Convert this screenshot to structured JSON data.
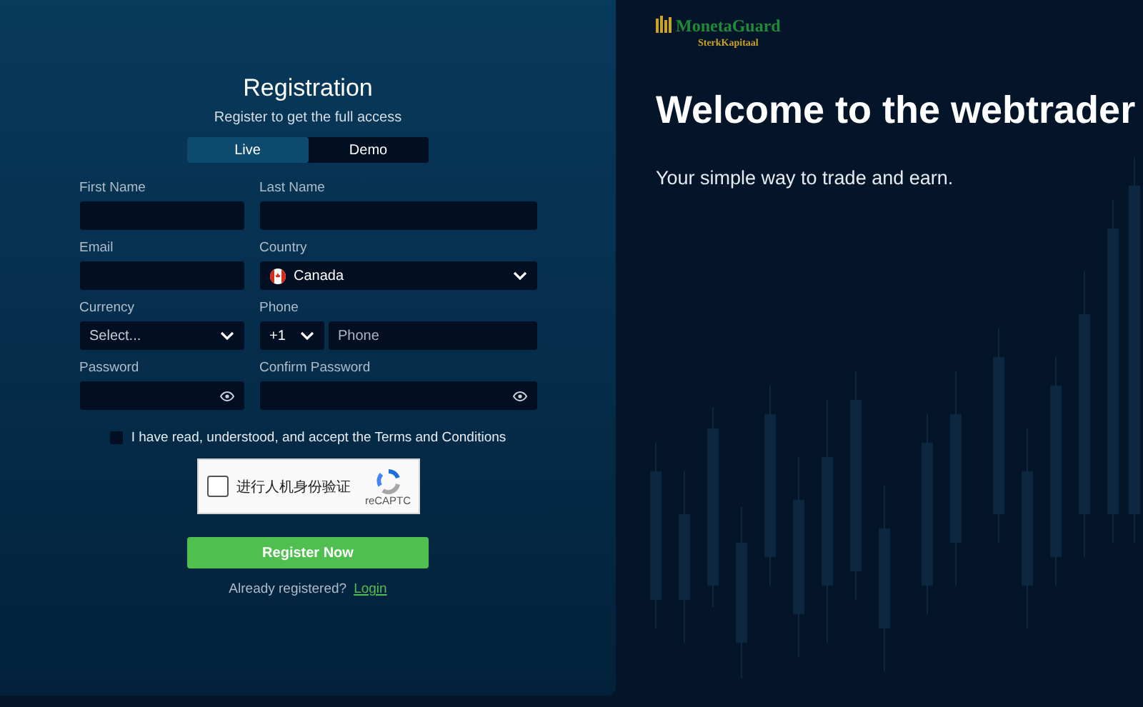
{
  "form": {
    "title": "Registration",
    "subtitle": "Register to get the full access",
    "tabs": [
      {
        "label": "Live",
        "selected": true
      },
      {
        "label": "Demo",
        "selected": false
      }
    ],
    "fields": [
      {
        "kind": "text",
        "label": "First Name"
      },
      {
        "kind": "text",
        "label": "Last Name"
      },
      {
        "kind": "text",
        "label": "Email"
      },
      {
        "kind": "select",
        "label": "Country",
        "value": "Canada",
        "flag": true
      },
      {
        "kind": "select",
        "label": "Currency",
        "placeholder": "Select..."
      },
      {
        "kind": "phone",
        "label": "Phone",
        "code": "+1",
        "placeholder": "Phone"
      },
      {
        "kind": "password",
        "label": "Password"
      },
      {
        "kind": "password",
        "label": "Confirm Password"
      }
    ],
    "terms": {
      "label": "I have read, understood, and accept the Terms and Conditions",
      "checked": false
    },
    "captcha": {
      "label": "进行人机身份验证",
      "brand": "reCAPTC",
      "checked": false
    },
    "submit": "Register Now",
    "login_prompt": "Already registered?",
    "login_link": "Login"
  },
  "hero": {
    "logo_name": "MonetaGuard",
    "logo_sub": "SterkKapitaal",
    "title": "Welcome to the webtrader",
    "subtitle": "Your simple way to trade and earn."
  }
}
